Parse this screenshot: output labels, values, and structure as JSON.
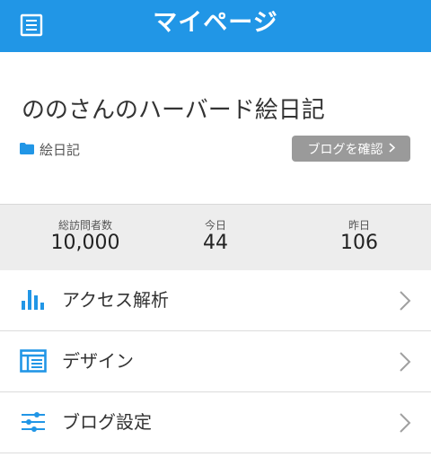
{
  "header": {
    "title": "マイページ",
    "menu_icon": "menu-list-icon",
    "background": "#2196e6"
  },
  "blog": {
    "title": "ののさんのハーバード絵日記",
    "category": "絵日記",
    "category_icon": "folder-icon",
    "confirm_button": "ブログを確認"
  },
  "stats": [
    {
      "label": "総訪問者数",
      "value": "10,000"
    },
    {
      "label": "今日",
      "value": "44"
    },
    {
      "label": "昨日",
      "value": "106"
    }
  ],
  "menu": [
    {
      "label": "アクセス解析",
      "icon": "bar-chart-icon"
    },
    {
      "label": "デザイン",
      "icon": "layout-icon"
    },
    {
      "label": "ブログ設定",
      "icon": "sliders-icon"
    }
  ],
  "colors": {
    "accent": "#2196e6",
    "button_gray": "#9a9a9a",
    "stats_bg": "#ededed"
  }
}
